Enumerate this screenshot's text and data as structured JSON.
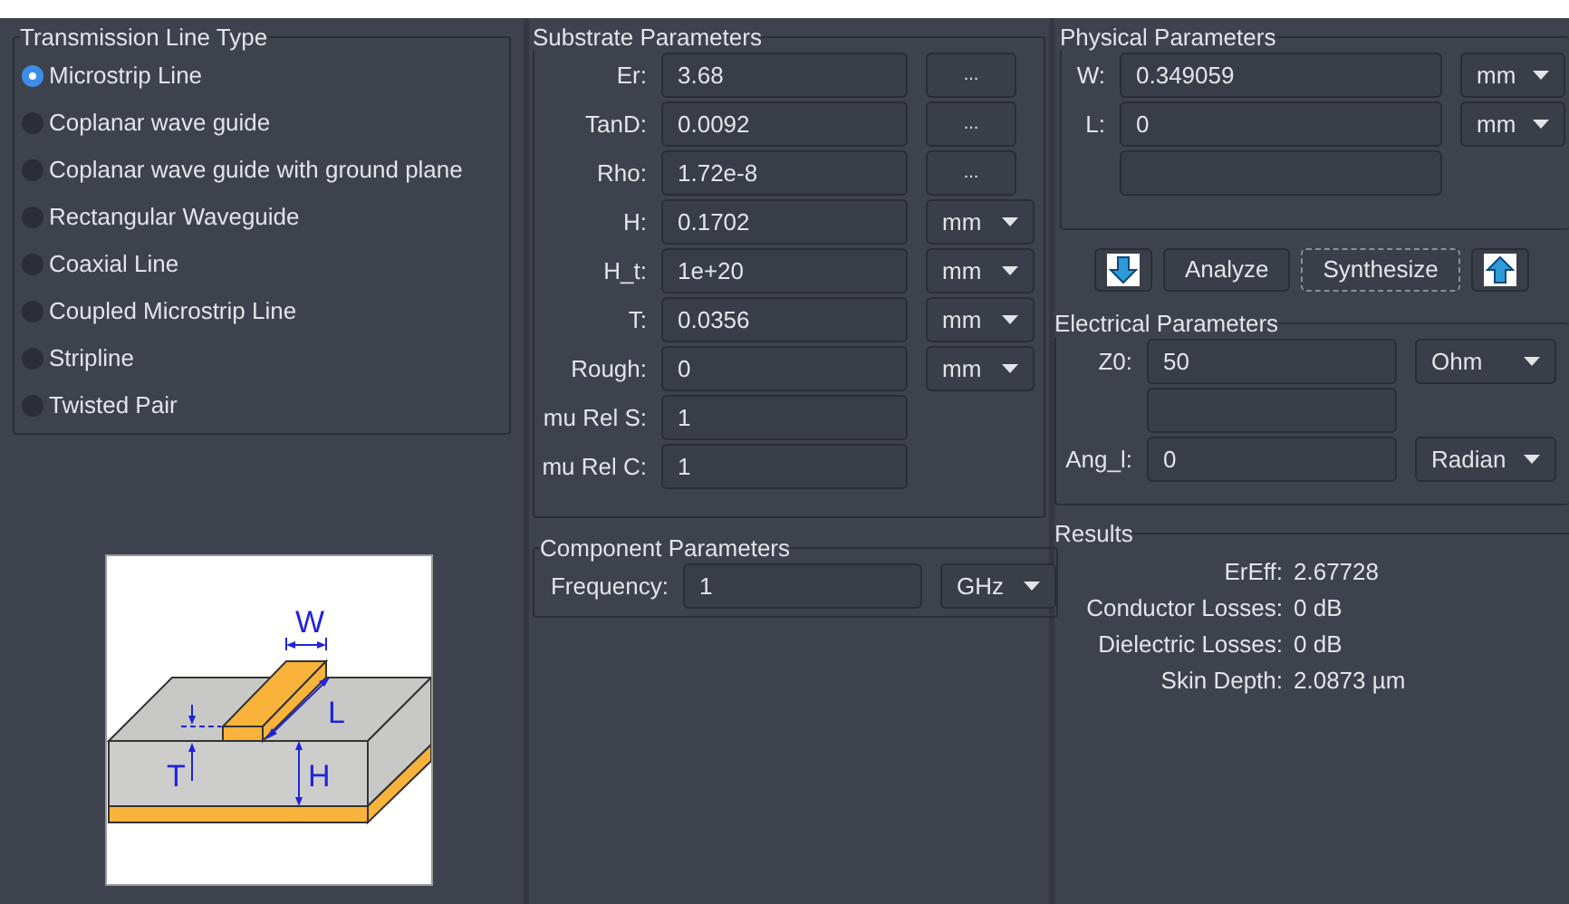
{
  "line_types": {
    "title": "Transmission Line Type",
    "options": [
      {
        "label": "Microstrip Line",
        "selected": true
      },
      {
        "label": "Coplanar wave guide",
        "selected": false
      },
      {
        "label": "Coplanar wave guide with ground plane",
        "selected": false
      },
      {
        "label": "Rectangular Waveguide",
        "selected": false
      },
      {
        "label": "Coaxial Line",
        "selected": false
      },
      {
        "label": "Coupled Microstrip Line",
        "selected": false
      },
      {
        "label": "Stripline",
        "selected": false
      },
      {
        "label": "Twisted Pair",
        "selected": false
      }
    ]
  },
  "diagram": {
    "labels": [
      "W",
      "L",
      "T",
      "H"
    ]
  },
  "substrate": {
    "title": "Substrate Parameters",
    "rows": [
      {
        "kind": "button",
        "label": "Er:",
        "value": "3.68",
        "button": "..."
      },
      {
        "kind": "button",
        "label": "TanD:",
        "value": "0.0092",
        "button": "..."
      },
      {
        "kind": "button",
        "label": "Rho:",
        "value": "1.72e-8",
        "button": "..."
      },
      {
        "kind": "unit",
        "label": "H:",
        "value": "0.1702",
        "unit": "mm"
      },
      {
        "kind": "unit",
        "label": "H_t:",
        "value": "1e+20",
        "unit": "mm"
      },
      {
        "kind": "unit",
        "label": "T:",
        "value": "0.0356",
        "unit": "mm"
      },
      {
        "kind": "unit",
        "label": "Rough:",
        "value": "0",
        "unit": "mm"
      },
      {
        "kind": "plain",
        "label": "mu Rel S:",
        "value": "1"
      },
      {
        "kind": "plain",
        "label": "mu Rel C:",
        "value": "1"
      }
    ]
  },
  "component": {
    "title": "Component Parameters",
    "rows": [
      {
        "kind": "unit",
        "label": "Frequency:",
        "value": "1",
        "unit": "GHz"
      }
    ]
  },
  "physical": {
    "title": "Physical Parameters",
    "rows": [
      {
        "kind": "unit",
        "label": "W:",
        "value": "0.349059",
        "unit": "mm"
      },
      {
        "kind": "unit",
        "label": "L:",
        "value": "0",
        "unit": "mm"
      },
      {
        "kind": "blank"
      }
    ]
  },
  "actions": [
    {
      "kind": "down-arrow"
    },
    {
      "kind": "text",
      "label": "Analyze",
      "focused": false
    },
    {
      "kind": "text",
      "label": "Synthesize",
      "focused": true
    },
    {
      "kind": "up-arrow"
    }
  ],
  "electrical": {
    "title": "Electrical Parameters",
    "rows": [
      {
        "kind": "unit",
        "label": "Z0:",
        "value": "50",
        "unit": "Ohm"
      },
      {
        "kind": "blank"
      },
      {
        "kind": "unit",
        "label": "Ang_l:",
        "value": "0",
        "unit": "Radian"
      }
    ]
  },
  "results": {
    "title": "Results",
    "rows": [
      {
        "label": "ErEff:",
        "value": "2.67728"
      },
      {
        "label": "Conductor Losses:",
        "value": "0 dB"
      },
      {
        "label": "Dielectric Losses:",
        "value": "0 dB"
      },
      {
        "label": "Skin Depth:",
        "value": "2.0873 µm"
      }
    ]
  }
}
